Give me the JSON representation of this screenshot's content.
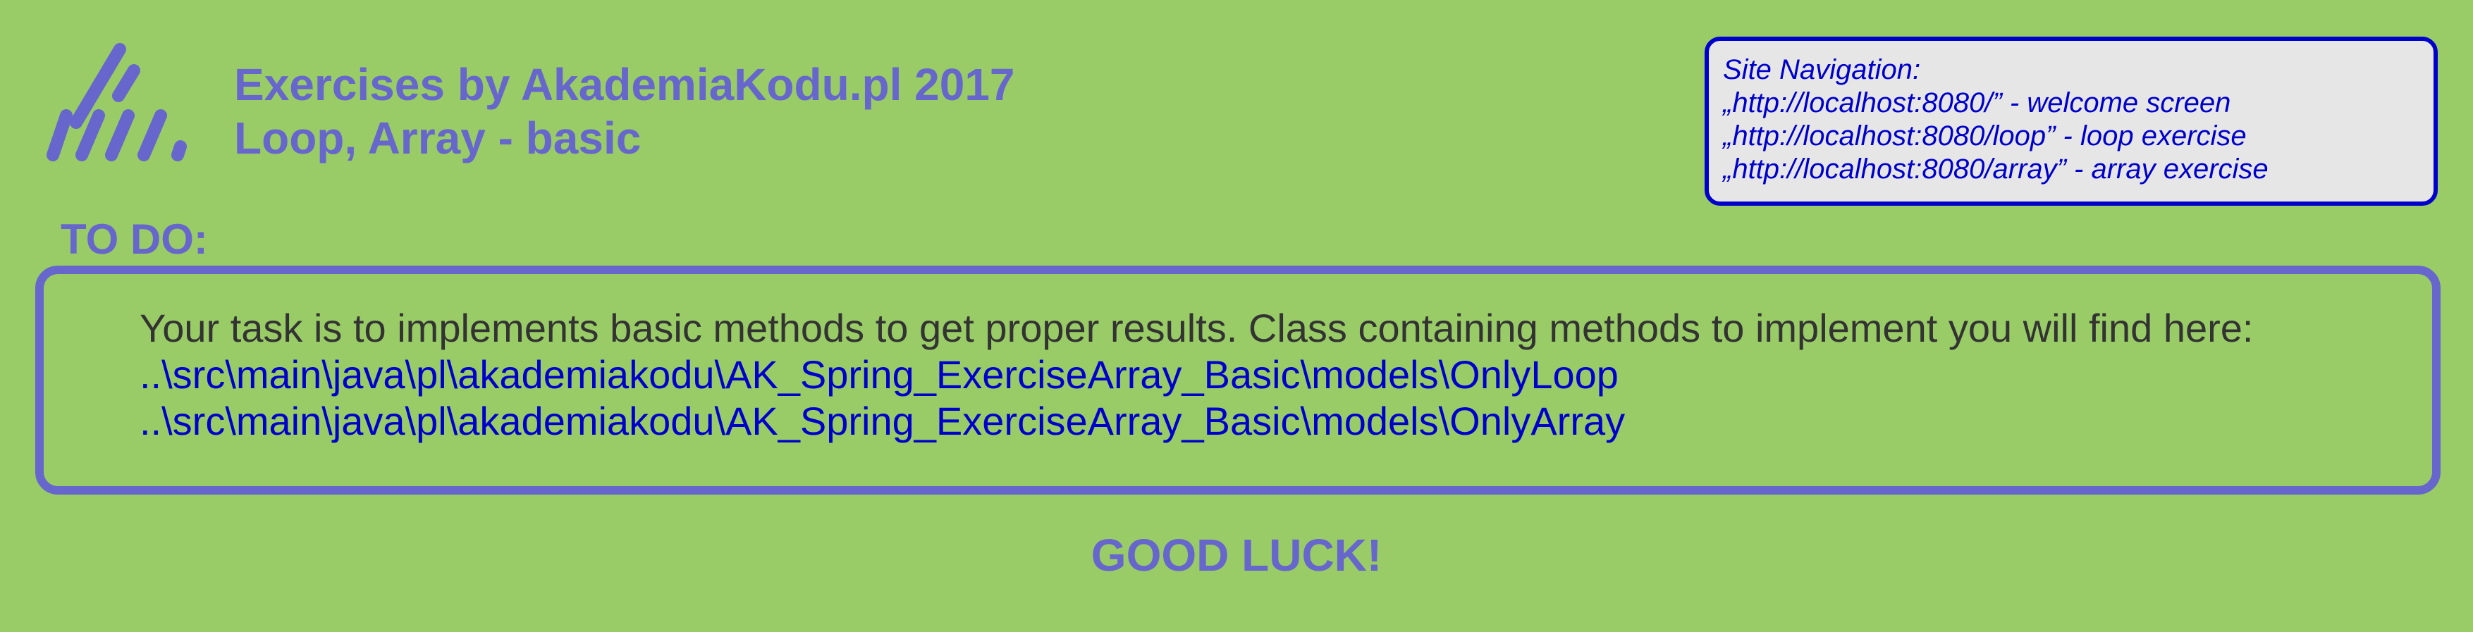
{
  "header": {
    "title_line1": "Exercises by AkademiaKodu.pl 2017",
    "title_line2": "Loop, Array - basic"
  },
  "nav": {
    "heading": "Site Navigation:",
    "items": [
      "„http://localhost:8080/” - welcome screen",
      "„http://localhost:8080/loop” - loop exercise",
      "„http://localhost:8080/array” - array exercise"
    ]
  },
  "todo": {
    "heading": "TO DO:",
    "description": "Your task is to implements basic methods to get proper results. Class containing methods to implement you will find here:",
    "paths": [
      "..\\src\\main\\java\\pl\\akademiakodu\\AK_Spring_ExerciseArray_Basic\\models\\OnlyLoop",
      "..\\src\\main\\java\\pl\\akademiakodu\\AK_Spring_ExerciseArray_Basic\\models\\OnlyArray"
    ]
  },
  "footer": {
    "good_luck": "GOOD LUCK!"
  },
  "colors": {
    "background": "#99cc66",
    "accent": "#6666cc",
    "link": "#0000cc",
    "nav_bg": "#e6e6e6",
    "text": "#333333"
  },
  "icons": {
    "logo": "akademiakodu-logo"
  }
}
